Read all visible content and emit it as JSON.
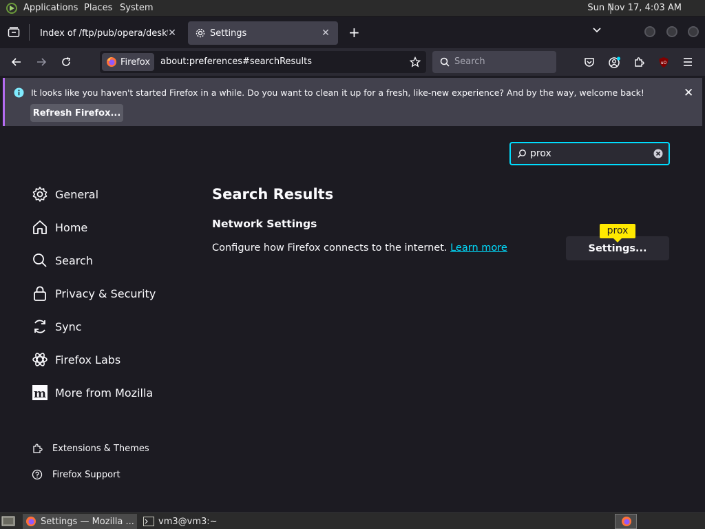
{
  "top_panel": {
    "menus": [
      "Applications",
      "Places",
      "System"
    ],
    "clock": "Sun Nov 17,  4:03 AM"
  },
  "tabs": [
    {
      "label": "Index of /ftp/pub/opera/desktop"
    },
    {
      "label": "Settings"
    }
  ],
  "navbar": {
    "identity_label": "Firefox",
    "url": "about:preferences#searchResults",
    "search_placeholder": "Search"
  },
  "notification": {
    "message": "It looks like you haven't started Firefox in a while. Do you want to clean it up for a fresh, like-new experience? And by the way, welcome back!",
    "button_label": "Refresh Firefox..."
  },
  "find": {
    "value": "prox"
  },
  "categories": [
    {
      "label": "General",
      "icon": "gear-icon"
    },
    {
      "label": "Home",
      "icon": "home-icon"
    },
    {
      "label": "Search",
      "icon": "search-icon"
    },
    {
      "label": "Privacy & Security",
      "icon": "lock-icon"
    },
    {
      "label": "Sync",
      "icon": "sync-icon"
    },
    {
      "label": "Firefox Labs",
      "icon": "labs-icon"
    },
    {
      "label": "More from Mozilla",
      "icon": "mozilla-icon"
    }
  ],
  "footer_links": [
    {
      "label": "Extensions & Themes",
      "icon": "puzzle-icon"
    },
    {
      "label": "Firefox Support",
      "icon": "help-icon"
    }
  ],
  "results": {
    "heading": "Search Results",
    "section_title": "Network Settings",
    "description": "Configure how Firefox connects to the internet.",
    "learn_more": "Learn more",
    "settings_button": "Settings...",
    "highlight_tooltip": "prox"
  },
  "taskbar": {
    "items": [
      "Settings — Mozilla ...",
      "vm3@vm3:~"
    ]
  },
  "colors": {
    "accent": "#00ddff",
    "tooltip": "#ffe900",
    "notification_border": "#b56cf2"
  }
}
